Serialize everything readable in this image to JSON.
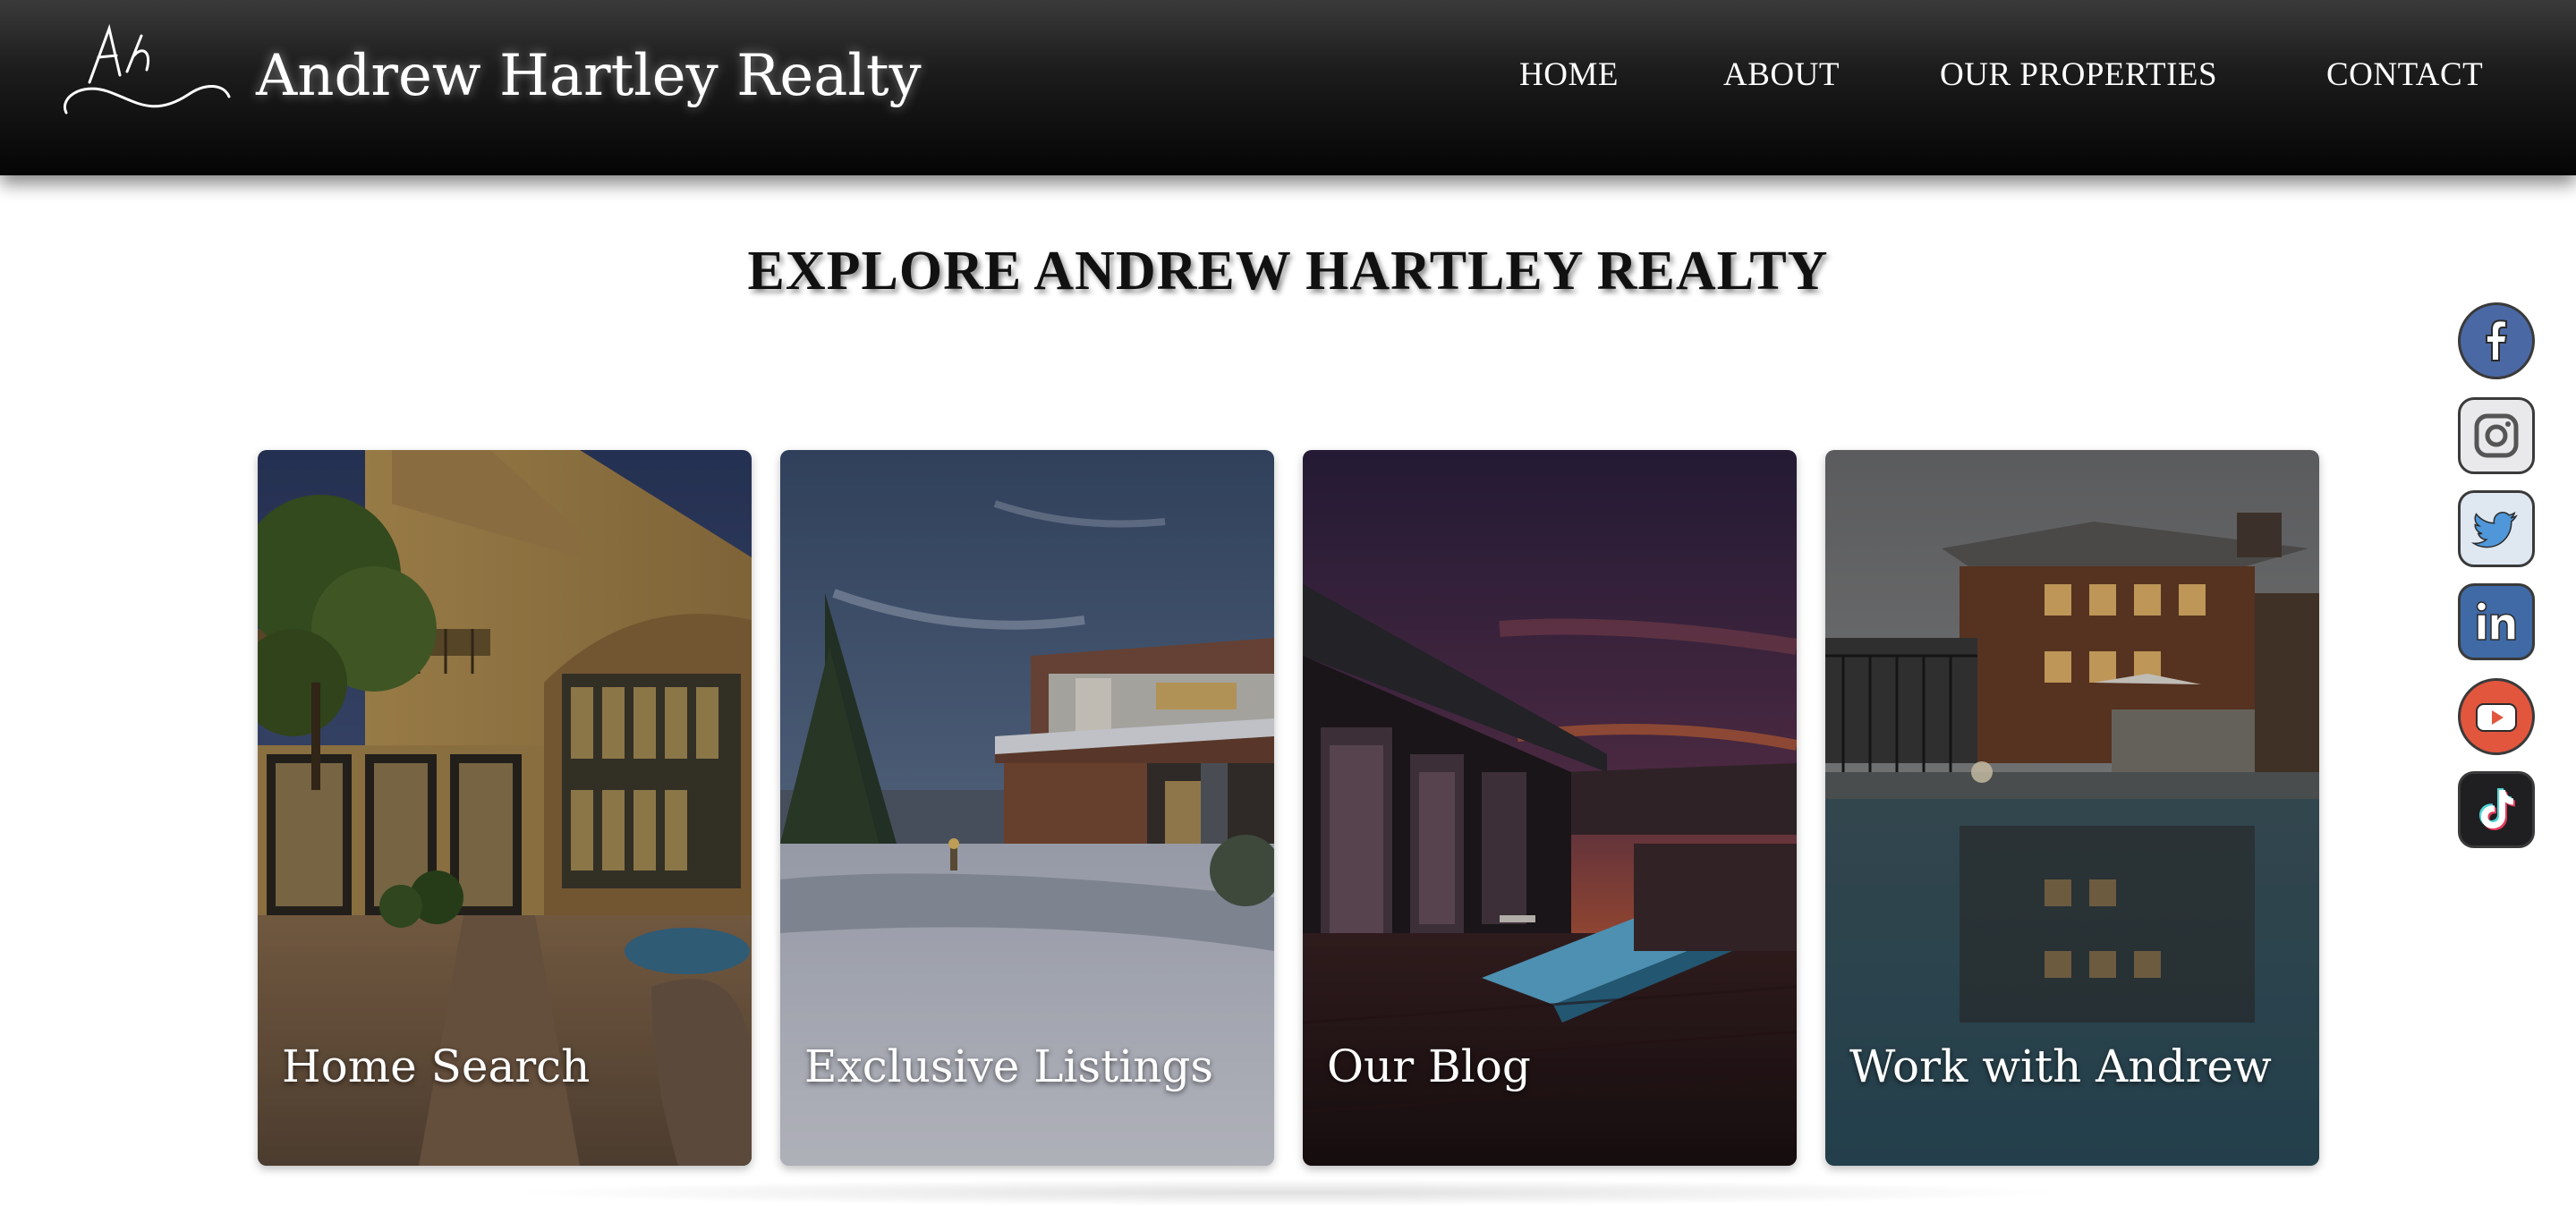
{
  "header": {
    "logo_icon": "ah-signature-logo",
    "brand_name": "Andrew Hartley Realty",
    "nav": {
      "home": "HOME",
      "about": "ABOUT",
      "properties": "OUR PROPERTIES",
      "contact": "CONTACT"
    }
  },
  "main": {
    "heading": "EXPLORE ANDREW HARTLEY REALTY",
    "cards": [
      {
        "label": "Home Search",
        "image": "stucco-villa-patio-photo"
      },
      {
        "label": "Exclusive Listings",
        "image": "modern-house-winter-snow-photo"
      },
      {
        "label": "Our Blog",
        "image": "house-pool-sunset-photo"
      },
      {
        "label": "Work with Andrew",
        "image": "lodge-house-pool-reflection-photo"
      }
    ]
  },
  "social_links": [
    {
      "icon": "facebook-icon",
      "color": "#4a68a4"
    },
    {
      "icon": "instagram-icon",
      "color": "#e9e9ec"
    },
    {
      "icon": "twitter-icon",
      "color": "#4f97d9"
    },
    {
      "icon": "linkedin-icon",
      "color": "#3f6aa6"
    },
    {
      "icon": "youtube-icon",
      "color": "#e2563d"
    },
    {
      "icon": "tiktok-icon",
      "color": "#1f1f22"
    }
  ],
  "colors": {
    "header_bg": "#111111",
    "header_text": "#ffffff",
    "heading_text": "#111111",
    "page_bg": "#ffffff"
  }
}
